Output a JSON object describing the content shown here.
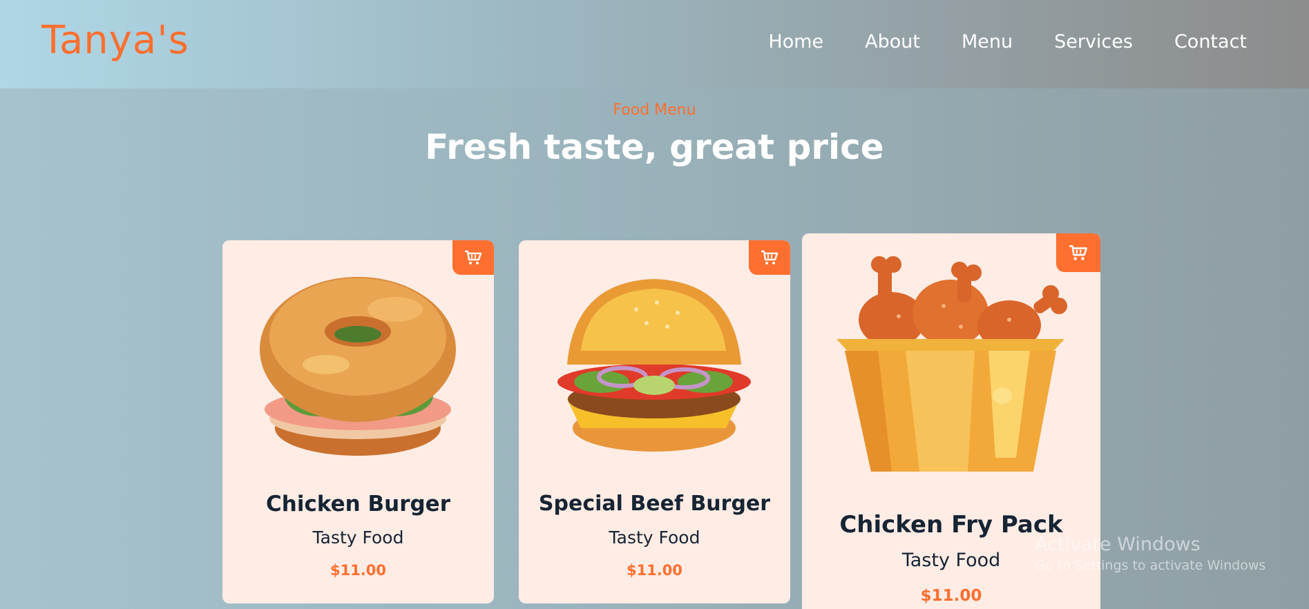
{
  "header": {
    "logo": "Tanya's",
    "nav": [
      "Home",
      "About",
      "Menu",
      "Services",
      "Contact"
    ]
  },
  "section": {
    "label": "Food Menu",
    "title": "Fresh taste, great price"
  },
  "cards": [
    {
      "name": "Chicken Burger",
      "subtitle": "Tasty Food",
      "price": "$11.00",
      "icon": "cart-icon",
      "image": "chicken-burger-image"
    },
    {
      "name": "Special Beef Burger",
      "subtitle": "Tasty Food",
      "price": "$11.00",
      "icon": "cart-icon",
      "image": "beef-burger-image"
    },
    {
      "name": "Chicken Fry Pack",
      "subtitle": "Tasty Food",
      "price": "$11.00",
      "icon": "cart-icon",
      "image": "chicken-bucket-image"
    }
  ],
  "watermark": {
    "title": "Activate Windows",
    "subtitle": "Go to Settings to activate Windows"
  },
  "colors": {
    "accent": "#ff6f2f",
    "card_bg": "#ffece5",
    "heading": "#162433"
  }
}
